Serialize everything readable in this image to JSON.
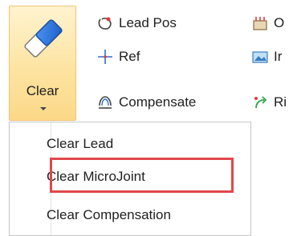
{
  "ribbon": {
    "clear_button": {
      "label": "Clear",
      "icon": "eraser-icon"
    },
    "items_col1": [
      {
        "label": "Lead Pos",
        "icon": "lead-pos-icon"
      },
      {
        "label": "Ref",
        "icon": "crosshair-icon"
      },
      {
        "label": "Compensate",
        "icon": "compensate-icon"
      }
    ],
    "items_col2": [
      {
        "label": "O",
        "icon": "building-icon"
      },
      {
        "label": "Ir",
        "icon": "image-icon"
      },
      {
        "label": "Ri",
        "icon": "reverse-arrows-icon"
      }
    ]
  },
  "menu": {
    "items": [
      {
        "label": "Clear Lead"
      },
      {
        "label": "Clear MicroJoint"
      },
      {
        "label": "Clear Compensation"
      }
    ]
  },
  "colors": {
    "highlight_border": "#e2474b",
    "button_pressed": "#fde4a2",
    "icon_blue": "#2b6fd6",
    "icon_red": "#e03b3b"
  }
}
